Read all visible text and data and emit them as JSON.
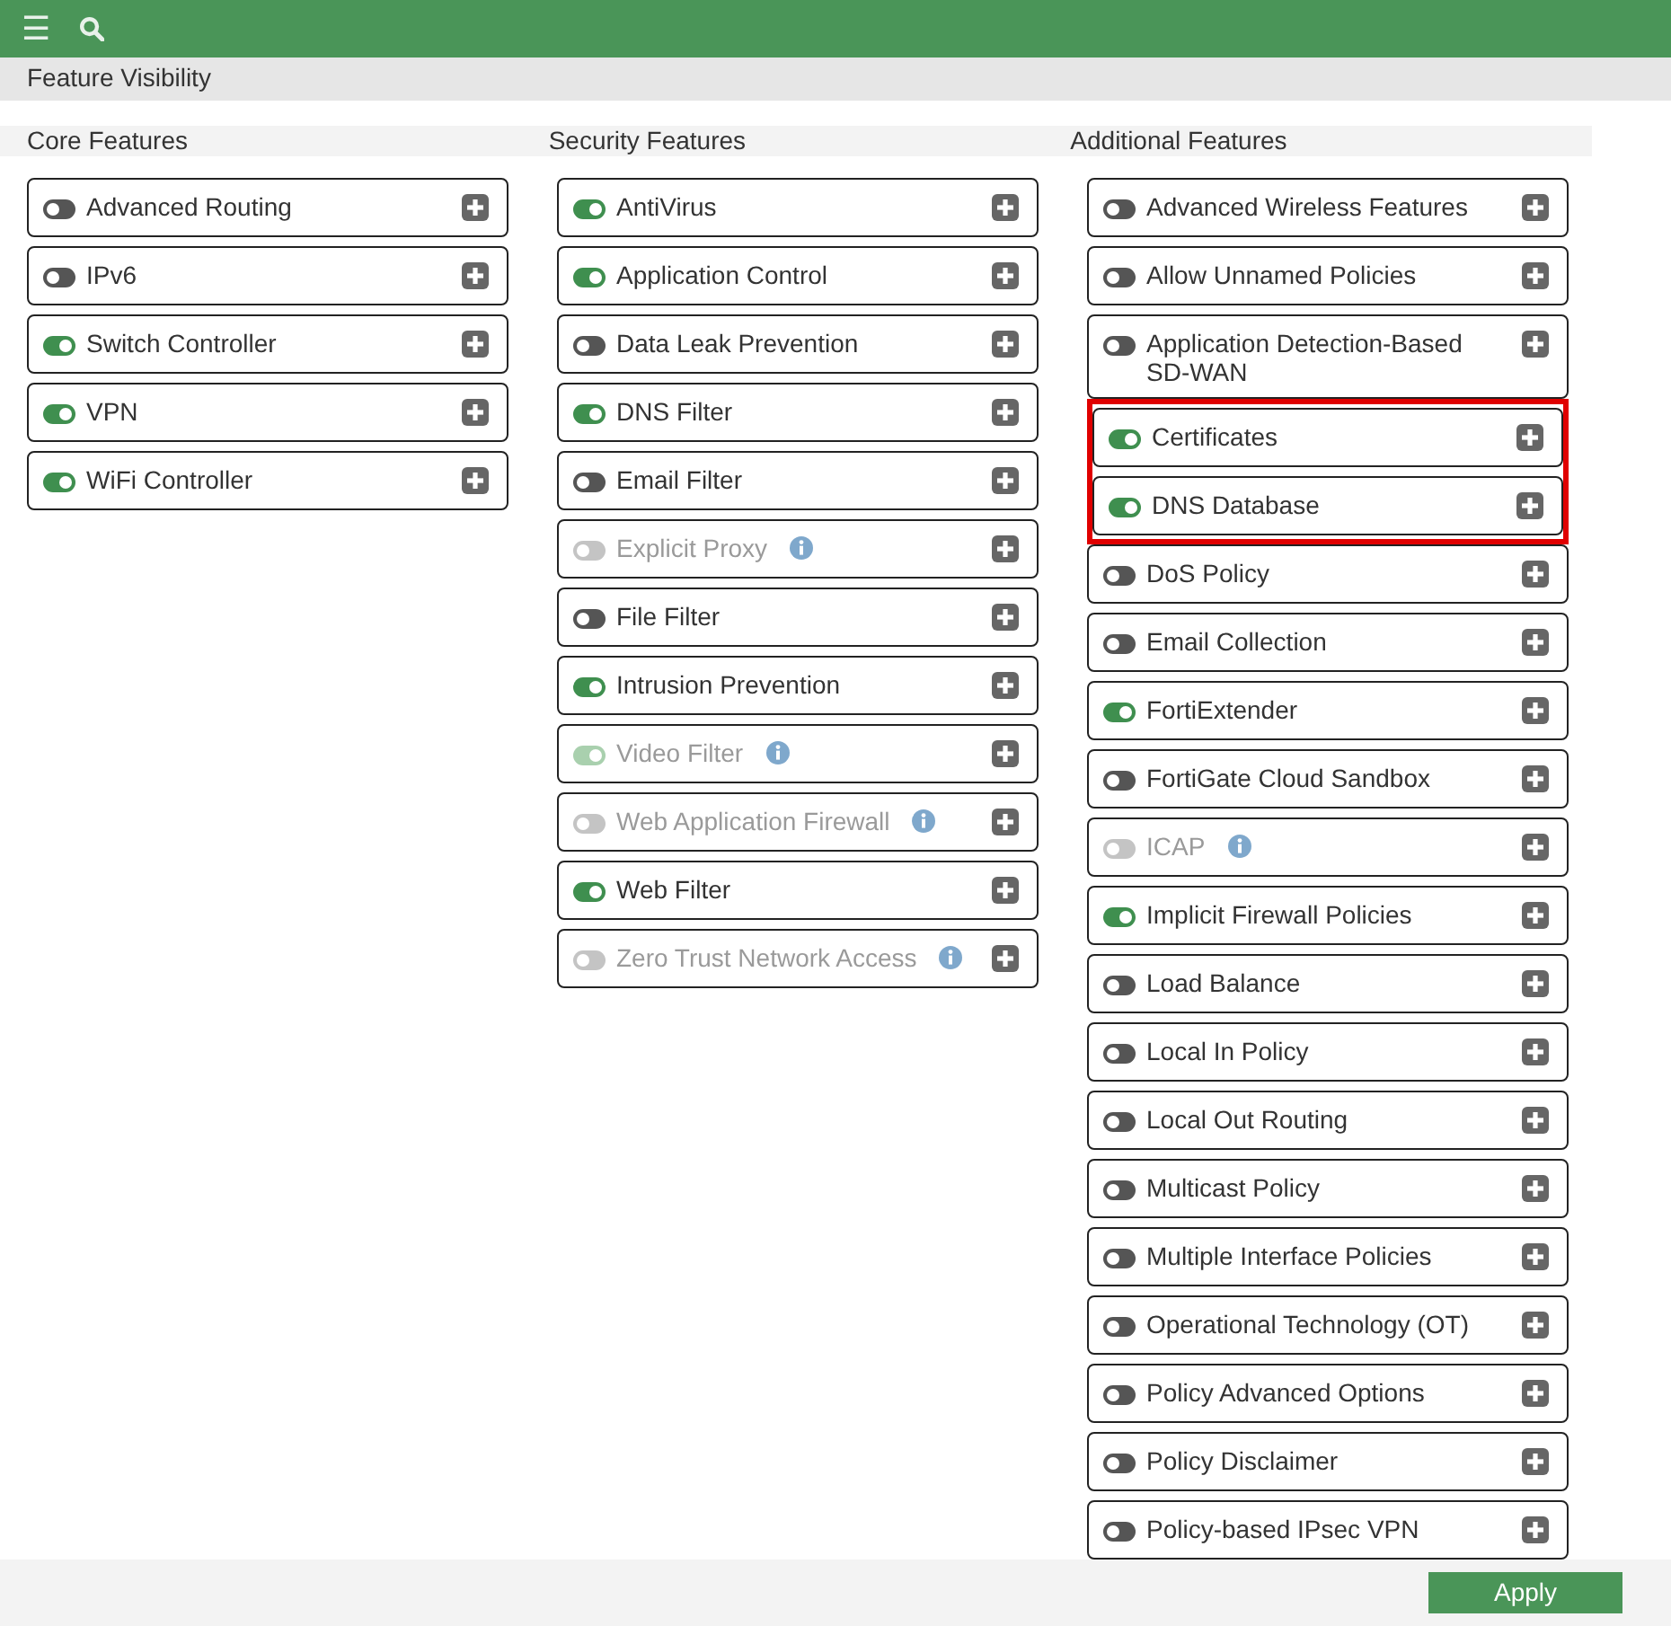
{
  "topbar": {
    "menu_icon": "☰"
  },
  "page_title": "Feature Visibility",
  "columns": [
    {
      "title": "Core Features",
      "items": [
        {
          "label": "Advanced Routing",
          "on": false,
          "disabled": false,
          "info": false,
          "highlighted": false
        },
        {
          "label": "IPv6",
          "on": false,
          "disabled": false,
          "info": false,
          "highlighted": false
        },
        {
          "label": "Switch Controller",
          "on": true,
          "disabled": false,
          "info": false,
          "highlighted": false
        },
        {
          "label": "VPN",
          "on": true,
          "disabled": false,
          "info": false,
          "highlighted": false
        },
        {
          "label": "WiFi Controller",
          "on": true,
          "disabled": false,
          "info": false,
          "highlighted": false
        }
      ]
    },
    {
      "title": "Security Features",
      "items": [
        {
          "label": "AntiVirus",
          "on": true,
          "disabled": false,
          "info": false,
          "highlighted": false
        },
        {
          "label": "Application Control",
          "on": true,
          "disabled": false,
          "info": false,
          "highlighted": false
        },
        {
          "label": "Data Leak Prevention",
          "on": false,
          "disabled": false,
          "info": false,
          "highlighted": false
        },
        {
          "label": "DNS Filter",
          "on": true,
          "disabled": false,
          "info": false,
          "highlighted": false
        },
        {
          "label": "Email Filter",
          "on": false,
          "disabled": false,
          "info": false,
          "highlighted": false
        },
        {
          "label": "Explicit Proxy",
          "on": false,
          "disabled": true,
          "info": true,
          "highlighted": false
        },
        {
          "label": "File Filter",
          "on": false,
          "disabled": false,
          "info": false,
          "highlighted": false
        },
        {
          "label": "Intrusion Prevention",
          "on": true,
          "disabled": false,
          "info": false,
          "highlighted": false
        },
        {
          "label": "Video Filter",
          "on": true,
          "disabled": true,
          "info": true,
          "highlighted": false
        },
        {
          "label": "Web Application Firewall",
          "on": false,
          "disabled": true,
          "info": true,
          "highlighted": false
        },
        {
          "label": "Web Filter",
          "on": true,
          "disabled": false,
          "info": false,
          "highlighted": false
        },
        {
          "label": "Zero Trust Network Access",
          "on": false,
          "disabled": true,
          "info": true,
          "highlighted": false
        }
      ]
    },
    {
      "title": "Additional Features",
      "items": [
        {
          "label": "Advanced Wireless Features",
          "on": false,
          "disabled": false,
          "info": false,
          "highlighted": false
        },
        {
          "label": "Allow Unnamed Policies",
          "on": false,
          "disabled": false,
          "info": false,
          "highlighted": false
        },
        {
          "label": "Application Detection-Based SD-WAN",
          "on": false,
          "disabled": false,
          "info": false,
          "highlighted": false
        },
        {
          "label": "Certificates",
          "on": true,
          "disabled": false,
          "info": false,
          "highlighted": true
        },
        {
          "label": "DNS Database",
          "on": true,
          "disabled": false,
          "info": false,
          "highlighted": true
        },
        {
          "label": "DoS Policy",
          "on": false,
          "disabled": false,
          "info": false,
          "highlighted": false
        },
        {
          "label": "Email Collection",
          "on": false,
          "disabled": false,
          "info": false,
          "highlighted": false
        },
        {
          "label": "FortiExtender",
          "on": true,
          "disabled": false,
          "info": false,
          "highlighted": false
        },
        {
          "label": "FortiGate Cloud Sandbox",
          "on": false,
          "disabled": false,
          "info": false,
          "highlighted": false
        },
        {
          "label": "ICAP",
          "on": false,
          "disabled": true,
          "info": true,
          "highlighted": false
        },
        {
          "label": "Implicit Firewall Policies",
          "on": true,
          "disabled": false,
          "info": false,
          "highlighted": false
        },
        {
          "label": "Load Balance",
          "on": false,
          "disabled": false,
          "info": false,
          "highlighted": false
        },
        {
          "label": "Local In Policy",
          "on": false,
          "disabled": false,
          "info": false,
          "highlighted": false
        },
        {
          "label": "Local Out Routing",
          "on": false,
          "disabled": false,
          "info": false,
          "highlighted": false
        },
        {
          "label": "Multicast Policy",
          "on": false,
          "disabled": false,
          "info": false,
          "highlighted": false
        },
        {
          "label": "Multiple Interface Policies",
          "on": false,
          "disabled": false,
          "info": false,
          "highlighted": false
        },
        {
          "label": "Operational Technology (OT)",
          "on": false,
          "disabled": false,
          "info": false,
          "highlighted": false
        },
        {
          "label": "Policy Advanced Options",
          "on": false,
          "disabled": false,
          "info": false,
          "highlighted": false
        },
        {
          "label": "Policy Disclaimer",
          "on": false,
          "disabled": false,
          "info": false,
          "highlighted": false
        },
        {
          "label": "Policy-based IPsec VPN",
          "on": false,
          "disabled": false,
          "info": false,
          "highlighted": false
        }
      ]
    }
  ],
  "apply_button": "Apply"
}
